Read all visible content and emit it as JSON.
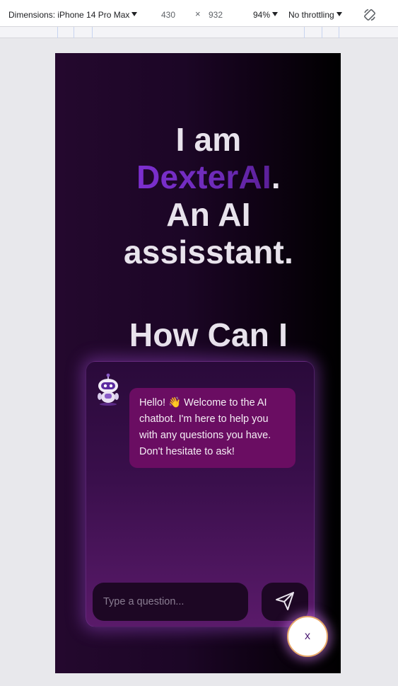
{
  "devtools": {
    "dimensions_label": "Dimensions: iPhone 14 Pro Max",
    "width": "430",
    "times": "×",
    "height": "932",
    "zoom": "94%",
    "throttling": "No throttling"
  },
  "hero": {
    "line1": "I am",
    "brand": "DexterAI",
    "brand_suffix": ".",
    "line3": "An AI",
    "line4": "assisstant.",
    "line5": "How Can I"
  },
  "chat": {
    "welcome_message": "Hello! 👋 Welcome to the AI chatbot. I'm here to help you with any questions you have. Don't hesitate to ask!",
    "input_placeholder": "Type a question...",
    "close_label": "x"
  },
  "colors": {
    "brand_purple": "#7d2fd0",
    "bubble_bg": "#6a0d62",
    "panel_glow": "#9646c8",
    "fab_border": "#e7a96a"
  },
  "icons": {
    "send": "paper-plane-icon",
    "bot": "robot-icon",
    "rotate": "rotate-device-icon"
  }
}
